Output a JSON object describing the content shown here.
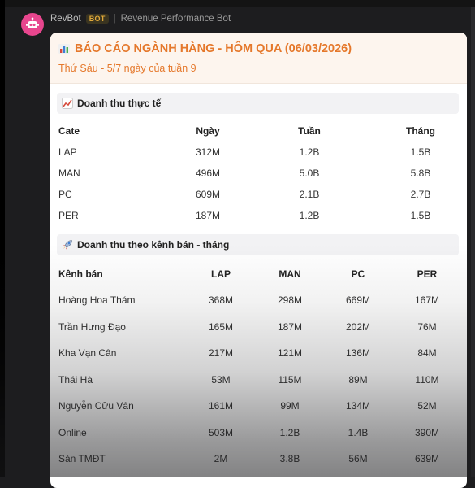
{
  "bot": {
    "name": "RevBot",
    "badge": "BOT",
    "separator": "|",
    "description": "Revenue Performance Bot"
  },
  "report": {
    "title": "BÁO CÁO NGÀNH HÀNG - HÔM QUA (06/03/2026)",
    "subtitle": "Thứ Sáu - 5/7 ngày của tuần 9"
  },
  "section1": {
    "title": "Doanh thu thực tế",
    "headers": [
      "Cate",
      "Ngày",
      "Tuần",
      "Tháng"
    ],
    "rows": [
      [
        "LAP",
        "312M",
        "1.2B",
        "1.5B"
      ],
      [
        "MAN",
        "496M",
        "5.0B",
        "5.8B"
      ],
      [
        "PC",
        "609M",
        "2.1B",
        "2.7B"
      ],
      [
        "PER",
        "187M",
        "1.2B",
        "1.5B"
      ]
    ]
  },
  "section2": {
    "title": "Doanh thu theo kênh bán - tháng",
    "headers": [
      "Kênh bán",
      "LAP",
      "MAN",
      "PC",
      "PER"
    ],
    "rows": [
      [
        "Hoàng Hoa Thám",
        "368M",
        "298M",
        "669M",
        "167M"
      ],
      [
        "Trần Hưng Đạo",
        "165M",
        "187M",
        "202M",
        "76M"
      ],
      [
        "Kha Vạn Cân",
        "217M",
        "121M",
        "136M",
        "84M"
      ],
      [
        "Thái Hà",
        "53M",
        "115M",
        "89M",
        "110M"
      ],
      [
        "Nguyễn Cửu Vân",
        "161M",
        "99M",
        "134M",
        "52M"
      ],
      [
        "Online",
        "503M",
        "1.2B",
        "1.4B",
        "390M"
      ],
      [
        "Sàn TMĐT",
        "2M",
        "3.8B",
        "56M",
        "639M"
      ]
    ]
  },
  "icons": {
    "avatar": "robot-icon",
    "title": "bar-chart-icon",
    "section1": "chart-increasing-icon",
    "section2": "rocket-icon"
  },
  "colors": {
    "accent": "#e5782b",
    "avatar_bg": "#e8468e",
    "badge": "#e0a83a"
  }
}
